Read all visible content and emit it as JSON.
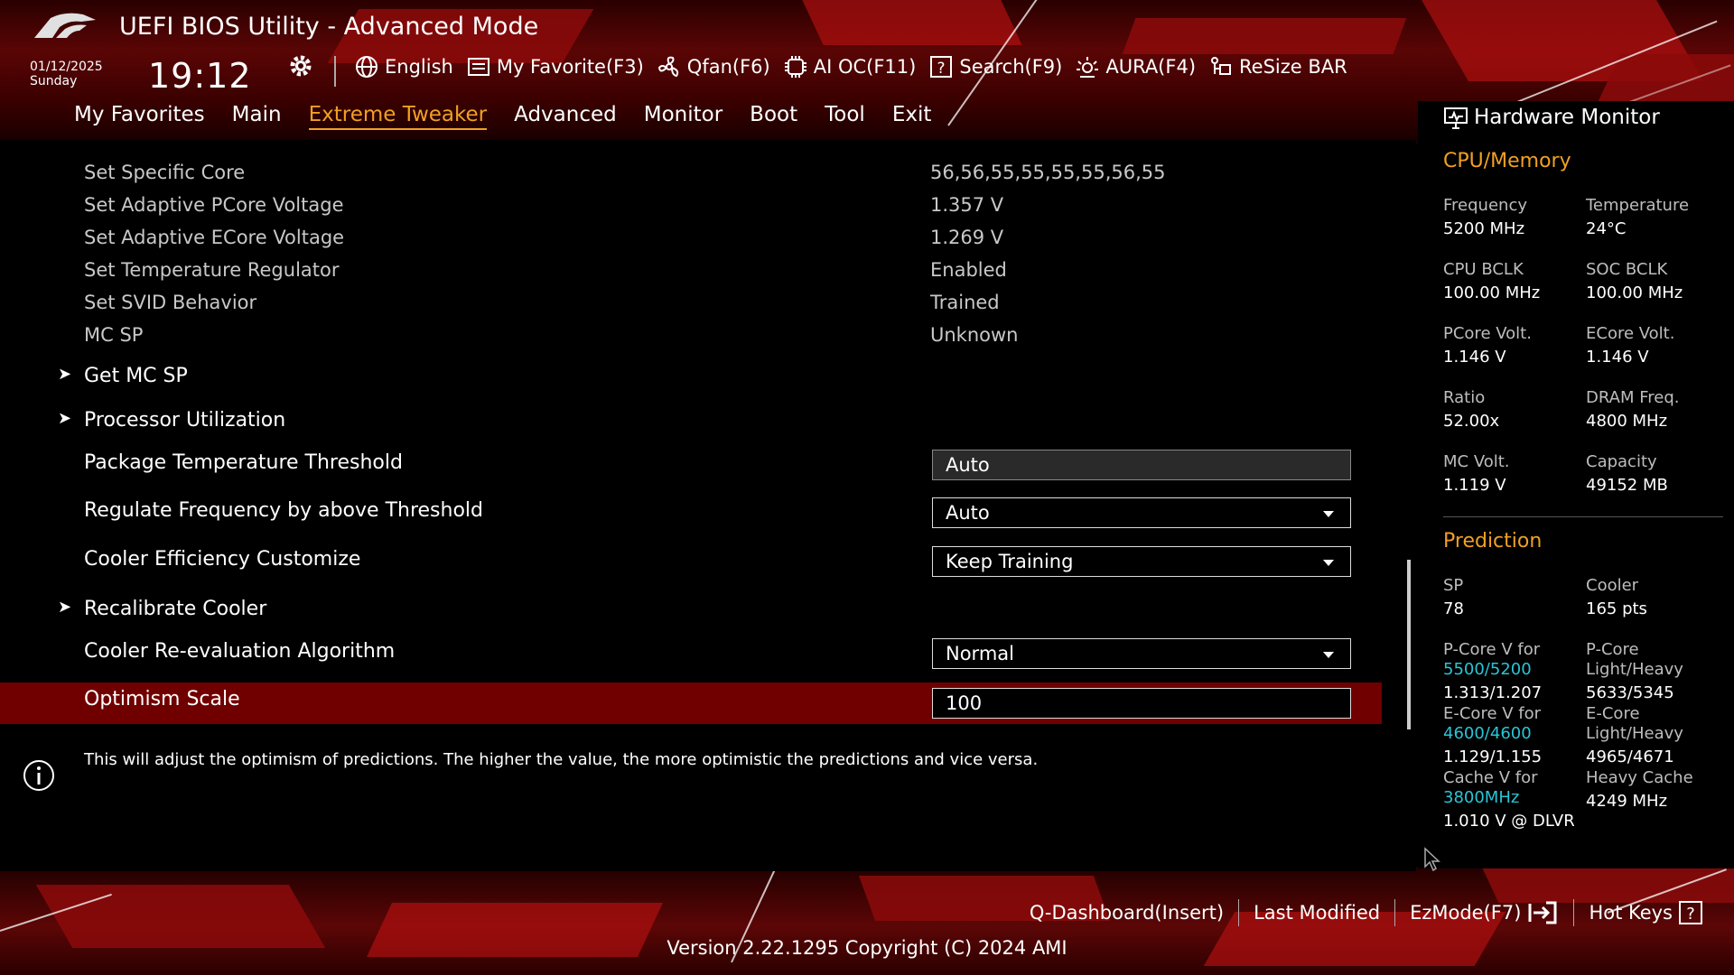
{
  "header": {
    "title": "UEFI BIOS Utility - Advanced Mode",
    "date": "01/12/2025",
    "day": "Sunday",
    "time": "19:12"
  },
  "toolbar": [
    {
      "icon": "globe-icon",
      "label": "English"
    },
    {
      "icon": "favorite-icon",
      "label": "My Favorite(F3)"
    },
    {
      "icon": "fan-icon",
      "label": "Qfan(F6)"
    },
    {
      "icon": "ai-chip-icon",
      "label": "AI OC(F11)"
    },
    {
      "icon": "search-icon",
      "label": "Search(F9)"
    },
    {
      "icon": "aura-icon",
      "label": "AURA(F4)"
    },
    {
      "icon": "resize-bar-icon",
      "label": "ReSize BAR"
    }
  ],
  "tabs": [
    {
      "label": "My Favorites",
      "active": false
    },
    {
      "label": "Main",
      "active": false
    },
    {
      "label": "Extreme Tweaker",
      "active": true
    },
    {
      "label": "Advanced",
      "active": false
    },
    {
      "label": "Monitor",
      "active": false
    },
    {
      "label": "Boot",
      "active": false
    },
    {
      "label": "Tool",
      "active": false
    },
    {
      "label": "Exit",
      "active": false
    }
  ],
  "settings": {
    "info_rows": [
      {
        "label": "Set Specific Core",
        "value": "56,56,55,55,55,55,56,55"
      },
      {
        "label": "Set Adaptive PCore Voltage",
        "value": "1.357 V"
      },
      {
        "label": "Set Adaptive ECore Voltage",
        "value": "1.269 V"
      },
      {
        "label": "Set Temperature Regulator",
        "value": "Enabled"
      },
      {
        "label": "Set SVID Behavior",
        "value": "Trained"
      },
      {
        "label": "MC SP",
        "value": "Unknown"
      }
    ],
    "get_mc_sp": "Get MC SP",
    "processor_utilization": "Processor Utilization",
    "pkg_temp_label": "Package Temperature Threshold",
    "pkg_temp_value": "Auto",
    "regulate_label": "Regulate Frequency by above Threshold",
    "regulate_value": "Auto",
    "cooler_eff_label": "Cooler Efficiency Customize",
    "cooler_eff_value": "Keep Training",
    "recalibrate": "Recalibrate Cooler",
    "reeval_label": "Cooler Re-evaluation Algorithm",
    "reeval_value": "Normal",
    "optimism_label": "Optimism Scale",
    "optimism_value": "100"
  },
  "help_text": "This will adjust the optimism of predictions. The higher the value, the more optimistic the predictions and vice versa.",
  "hardware_monitor": {
    "title": "Hardware Monitor",
    "cpu_memory_title": "CPU/Memory",
    "frequency_label": "Frequency",
    "frequency": "5200 MHz",
    "temperature_label": "Temperature",
    "temperature": "24°C",
    "cpu_bclk_label": "CPU BCLK",
    "cpu_bclk": "100.00 MHz",
    "soc_bclk_label": "SOC BCLK",
    "soc_bclk": "100.00 MHz",
    "pcore_volt_label": "PCore Volt.",
    "pcore_volt": "1.146 V",
    "ecore_volt_label": "ECore Volt.",
    "ecore_volt": "1.146 V",
    "ratio_label": "Ratio",
    "ratio": "52.00x",
    "dram_freq_label": "DRAM Freq.",
    "dram_freq": "4800 MHz",
    "mc_volt_label": "MC Volt.",
    "mc_volt": "1.119 V",
    "capacity_label": "Capacity",
    "capacity": "49152 MB",
    "prediction_title": "Prediction",
    "sp_label": "SP",
    "sp": "78",
    "cooler_label": "Cooler",
    "cooler": "165 pts",
    "pcore_v_for_label": "P-Core V for",
    "pcore_v_for_freq": "5500/5200",
    "pcore_v_for": "1.313/1.207",
    "pcore_lh_label1": "P-Core",
    "pcore_lh_label2": "Light/Heavy",
    "pcore_lh": "5633/5345",
    "ecore_v_for_label": "E-Core V for",
    "ecore_v_for_freq": "4600/4600",
    "ecore_v_for": "1.129/1.155",
    "ecore_lh_label1": "E-Core",
    "ecore_lh_label2": "Light/Heavy",
    "ecore_lh": "4965/4671",
    "cache_v_for_label": "Cache V for",
    "cache_v_for_freq": "3800MHz",
    "cache_v_for": "1.010 V @ DLVR",
    "heavy_cache_label": "Heavy Cache",
    "heavy_cache": "4249 MHz"
  },
  "footer": {
    "qdashboard": "Q-Dashboard(Insert)",
    "last_modified": "Last Modified",
    "ezmode": "EzMode(F7)",
    "hotkeys": "Hot Keys",
    "version": "Version 2.22.1295 Copyright (C) 2024 AMI"
  },
  "colors": {
    "accent": "#f0a024",
    "selected_row": "#700000",
    "cyan": "#29c5d6"
  }
}
